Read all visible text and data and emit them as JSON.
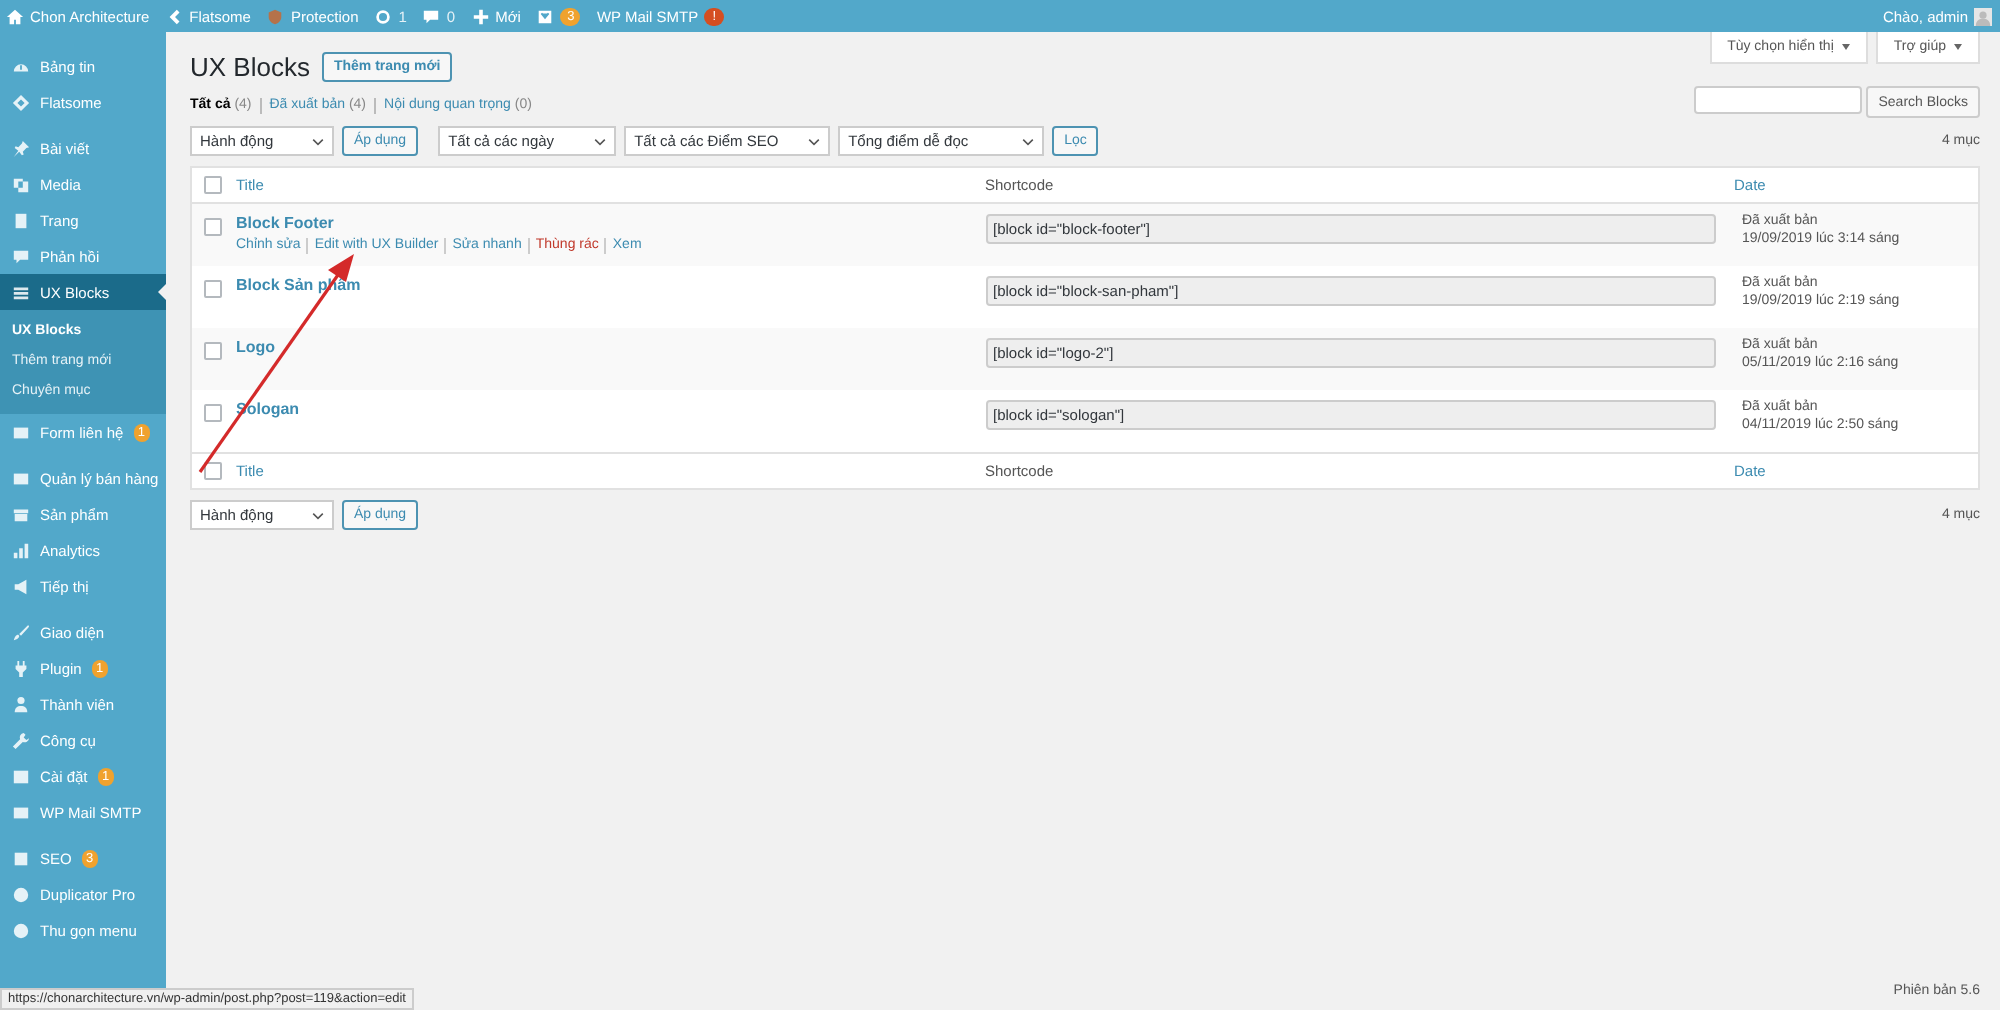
{
  "admin_bar": {
    "items": [
      {
        "label": "Chon Architecture"
      },
      {
        "label": "Flatsome"
      },
      {
        "label": "Protection"
      },
      {
        "label": "1"
      },
      {
        "label": "0"
      },
      {
        "label": "Mới"
      },
      {
        "badge": {
          "text": "3",
          "color": "#f0a22e"
        }
      },
      {
        "label": "WP Mail SMTP",
        "badge": {
          "text": "!",
          "color": "#d54e21"
        }
      }
    ],
    "greeting": "Chào, admin"
  },
  "sidebar": {
    "groups": [
      [
        {
          "label": "Bảng tin",
          "selected": false
        },
        {
          "label": "Flatsome",
          "selected": false
        }
      ],
      [
        {
          "label": "Bài viết",
          "selected": false
        },
        {
          "label": "Media",
          "selected": false
        },
        {
          "label": "Trang",
          "selected": false
        },
        {
          "label": "Phản hồi",
          "selected": false
        },
        {
          "label": "UX Blocks",
          "selected": true,
          "submenu": [
            {
              "label": "UX Blocks",
              "selected": true
            },
            {
              "label": "Thêm trang mới",
              "selected": false
            },
            {
              "label": "Chuyên mục",
              "selected": false
            }
          ]
        },
        {
          "label": "Form liên hệ",
          "selected": false,
          "badge": "1"
        }
      ],
      [
        {
          "label": "Quản lý bán hàng",
          "selected": false
        },
        {
          "label": "Sản phẩm",
          "selected": false
        },
        {
          "label": "Analytics",
          "selected": false
        },
        {
          "label": "Tiếp thị",
          "selected": false
        }
      ],
      [
        {
          "label": "Giao diện",
          "selected": false
        },
        {
          "label": "Plugin",
          "selected": false,
          "badge": "1"
        },
        {
          "label": "Thành viên",
          "selected": false
        },
        {
          "label": "Công cụ",
          "selected": false
        },
        {
          "label": "Cài đặt",
          "selected": false,
          "badge": "1"
        },
        {
          "label": "WP Mail SMTP",
          "selected": false
        }
      ],
      [
        {
          "label": "SEO",
          "selected": false,
          "badge": "3"
        },
        {
          "label": "Duplicator Pro",
          "selected": false
        },
        {
          "label": "Thu gọn menu",
          "selected": false
        }
      ]
    ]
  },
  "screen_meta": {
    "buttons": [
      "Tùy chọn hiển thị",
      "Trợ giúp"
    ]
  },
  "heading": {
    "title": "UX Blocks",
    "add_new": "Thêm trang mới"
  },
  "views": [
    {
      "label": "Tất cả",
      "count": "(4)",
      "selected": true
    },
    {
      "label": "Đã xuất bản",
      "count": "(4)",
      "selected": false
    },
    {
      "label": "Nội dung quan trọng",
      "count": "(0)",
      "selected": false
    }
  ],
  "search": {
    "button": "Search Blocks"
  },
  "top_nav": {
    "bulk_action": "Hành động",
    "apply": "Áp dụng",
    "filters": [
      "Tất cả các ngày",
      "Tất cả các Điểm SEO",
      "Tổng điểm dễ đọc"
    ],
    "filter_button": "Lọc",
    "count": "4 mục"
  },
  "table": {
    "columns": [
      {
        "label": "Title",
        "sortable": true
      },
      {
        "label": "Shortcode",
        "sortable": false
      },
      {
        "label": "Date",
        "sortable": true
      }
    ],
    "header_checked": false,
    "rows": [
      {
        "title": "Block Footer",
        "checked": false,
        "shortcode": "[block id=\"block-footer\"]",
        "status": "Đã xuất bản",
        "date": "19/09/2019 lúc 3:14 sáng",
        "row_actions": [
          {
            "label": "Chỉnh sửa",
            "kind": "normal"
          },
          {
            "label": "Edit with UX Builder",
            "kind": "normal"
          },
          {
            "label": "Sửa nhanh",
            "kind": "normal"
          },
          {
            "label": "Thùng rác",
            "kind": "danger"
          },
          {
            "label": "Xem",
            "kind": "normal"
          }
        ]
      },
      {
        "title": "Block Sản phẩm",
        "checked": false,
        "shortcode": "[block id=\"block-san-pham\"]",
        "status": "Đã xuất bản",
        "date": "19/09/2019 lúc 2:19 sáng"
      },
      {
        "title": "Logo",
        "checked": false,
        "shortcode": "[block id=\"logo-2\"]",
        "status": "Đã xuất bản",
        "date": "05/11/2019 lúc 2:16 sáng"
      },
      {
        "title": "Sologan",
        "checked": false,
        "shortcode": "[block id=\"sologan\"]",
        "status": "Đã xuất bản",
        "date": "04/11/2019 lúc 2:50 sáng"
      }
    ],
    "footer_columns": [
      {
        "label": "Title",
        "sortable": true
      },
      {
        "label": "Shortcode",
        "sortable": false
      },
      {
        "label": "Date",
        "sortable": true
      }
    ],
    "footer_checked": false
  },
  "bottom_nav": {
    "bulk_action": "Hành động",
    "apply": "Áp dụng",
    "count": "4 mục"
  },
  "footer": {
    "version": "Phiên bản 5.6"
  },
  "status_url": "https://chonarchitecture.vn/wp-admin/post.php?post=119&action=edit",
  "annotations": [
    {
      "kind": "arrow"
    }
  ]
}
